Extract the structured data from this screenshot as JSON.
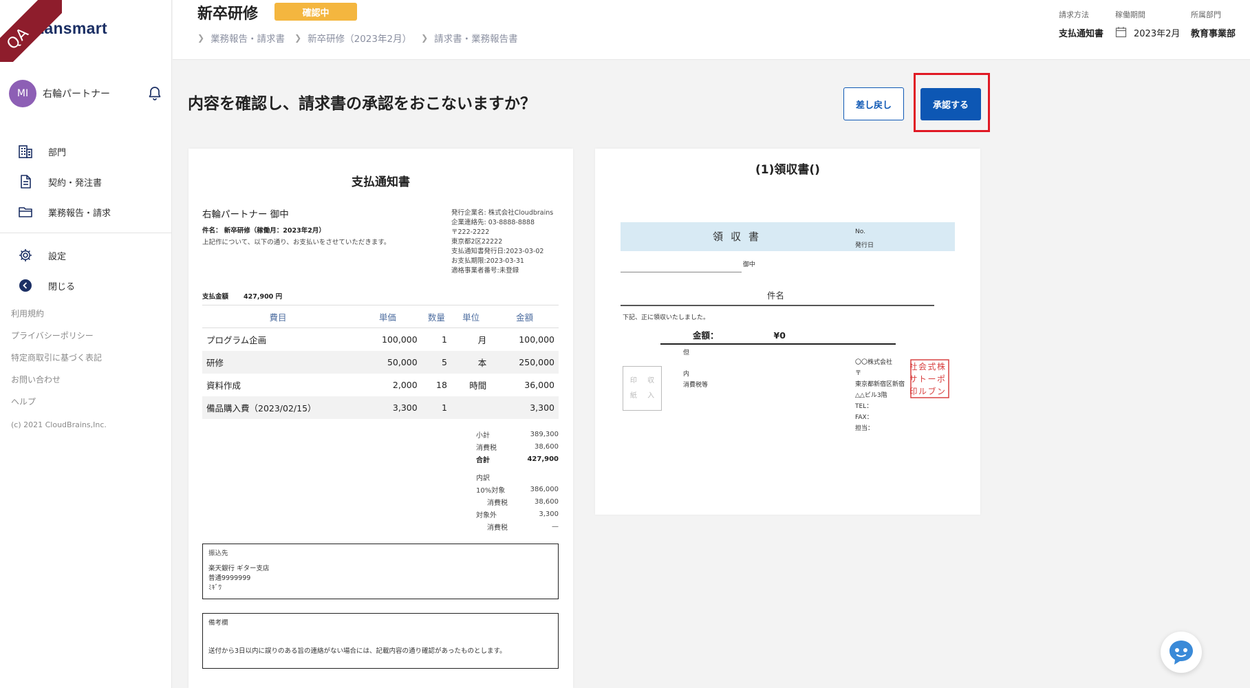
{
  "app": {
    "logo_text": "Lansmart",
    "ribbon_text": "QA"
  },
  "user": {
    "initials": "MI",
    "name": "右輪パートナー"
  },
  "nav": {
    "items": [
      {
        "label": "部門"
      },
      {
        "label": "契約・発注書"
      },
      {
        "label": "業務報告・請求"
      }
    ],
    "settings_label": "設定",
    "close_label": "閉じる"
  },
  "links": [
    "利用規約",
    "プライバシーポリシー",
    "特定商取引に基づく表記",
    "お問い合わせ",
    "ヘルプ"
  ],
  "copyright": "(c) 2021 CloudBrains,Inc.",
  "header": {
    "title": "新卒研修",
    "status_badge": "確認中",
    "breadcrumbs": [
      "業務報告・請求書",
      "新卒研修（2023年2月）",
      "請求書・業務報告書"
    ],
    "meta": [
      {
        "label": "請求方法",
        "value": "支払通知書"
      },
      {
        "label": "稼働期間",
        "value": "2023年2月"
      },
      {
        "label": "所属部門",
        "value": "教育事業部"
      }
    ]
  },
  "main": {
    "question": "内容を確認し、請求書の承認をおこないますか？",
    "reject_label": "差し戻し",
    "approve_label": "承認する"
  },
  "document": {
    "title": "支払通知書",
    "addressee": "右輪パートナー 御中",
    "subject": "件名： 新卒研修（稼働月：2023年2月）",
    "lead": "上記作について、以下の通り、お支払いをさせていただきます。",
    "issuer": [
      "発行企業名: 株式会社Cloudbrains",
      "企業連絡先: 03-8888-8888",
      "〒222-2222",
      "東京都2区22222",
      "支払通知書発行日:2023-03-02",
      "お支払期限:2023-03-31",
      "適格事業者番号:未登録"
    ],
    "payment_label": "支払金額",
    "payment_amount": "427,900 円",
    "columns": [
      "費目",
      "単価",
      "数量",
      "単位",
      "金額"
    ],
    "rows": [
      {
        "name": "プログラム企画",
        "price": "100,000",
        "qty": "1",
        "unit": "月",
        "amount": "100,000"
      },
      {
        "name": "研修",
        "price": "50,000",
        "qty": "5",
        "unit": "本",
        "amount": "250,000"
      },
      {
        "name": "資料作成",
        "price": "2,000",
        "qty": "18",
        "unit": "時間",
        "amount": "36,000"
      },
      {
        "name": "備品購入費（2023/02/15）",
        "price": "3,300",
        "qty": "1",
        "unit": "",
        "amount": "3,300"
      }
    ],
    "summary": {
      "subtotal_label": "小計",
      "subtotal": "389,300",
      "tax_label": "消費税",
      "tax": "38,600",
      "total_label": "合計",
      "total": "427,900",
      "breakdown_label": "内訳",
      "ten_label": "10%対象",
      "ten": "386,000",
      "ten_tax_label": "消費税",
      "ten_tax": "38,600",
      "exempt_label": "対象外",
      "exempt": "3,300",
      "exempt_tax_label": "消費税",
      "exempt_tax": "—"
    },
    "bank": {
      "label": "振込先",
      "lines": [
        "楽天銀行 ギター支店",
        "普通9999999",
        "ﾐｷﾞﾜ"
      ]
    },
    "remarks": {
      "label": "備考欄",
      "text": "送付から3日以内に誤りのある旨の連絡がない場合には、記載内容の通り確認があったものとします。"
    }
  },
  "receipt": {
    "title": "(1)領収書()",
    "heading": "領収書",
    "no_label": "No.",
    "issue_label": "発行日",
    "onchu": "御中",
    "kenmei": "件名",
    "note": "下記、正に領収いたしました。",
    "amount_label": "金額：",
    "amount": "¥0",
    "tadashi": "但",
    "stamp_text": [
      "印 収",
      "紙 入"
    ],
    "tax_lines": [
      "内",
      "消費税等"
    ],
    "company_lines": [
      "〇〇株式会社",
      "〒",
      "東京都新宿区新宿",
      "△△ビル3階",
      "TEL：",
      "FAX：",
      "担当："
    ],
    "hanko_chars": [
      [
        "株",
        "ポ",
        "ン"
      ],
      [
        "式",
        "ー",
        "ブ"
      ],
      [
        "会",
        "ト",
        "ル"
      ],
      [
        "社",
        "サ",
        "印"
      ]
    ]
  },
  "colors": {
    "accent": "#0d57b4",
    "badge": "#f4b63f",
    "focus": "#e01924",
    "ribbon": "#8e1d2c",
    "avatar": "#8d5fb5"
  }
}
